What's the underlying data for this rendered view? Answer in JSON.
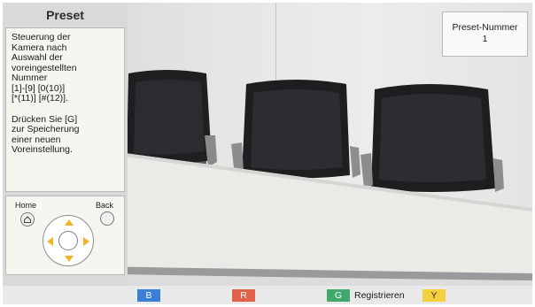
{
  "panel": {
    "title": "Preset",
    "help_text_1": "Steuerung der\nKamera nach\nAuswahl der\nvoreingestellten\nNummer\n[1]-[9] [0(10)]\n[*(11)] [#(12)].",
    "help_text_2": "Drücken Sie [G]\nzur Speicherung\neiner neuen\nVoreinstellung.",
    "home_label": "Home",
    "back_label": "Back"
  },
  "preset": {
    "label": "Preset-Nummer",
    "number": "1"
  },
  "bottom_bar": {
    "keys": [
      {
        "key": "B",
        "color": "#3d7fd6",
        "text_color": "#ffffff",
        "label": ""
      },
      {
        "key": "R",
        "color": "#e0614a",
        "text_color": "#ffffff",
        "label": ""
      },
      {
        "key": "G",
        "color": "#3fa86a",
        "text_color": "#ffffff",
        "label": "Registrieren"
      },
      {
        "key": "Y",
        "color": "#f4cf3e",
        "text_color": "#333333",
        "label": ""
      }
    ]
  },
  "colors": {
    "arrow": "#f0b428",
    "panel_bg": "#d9d9d9"
  }
}
